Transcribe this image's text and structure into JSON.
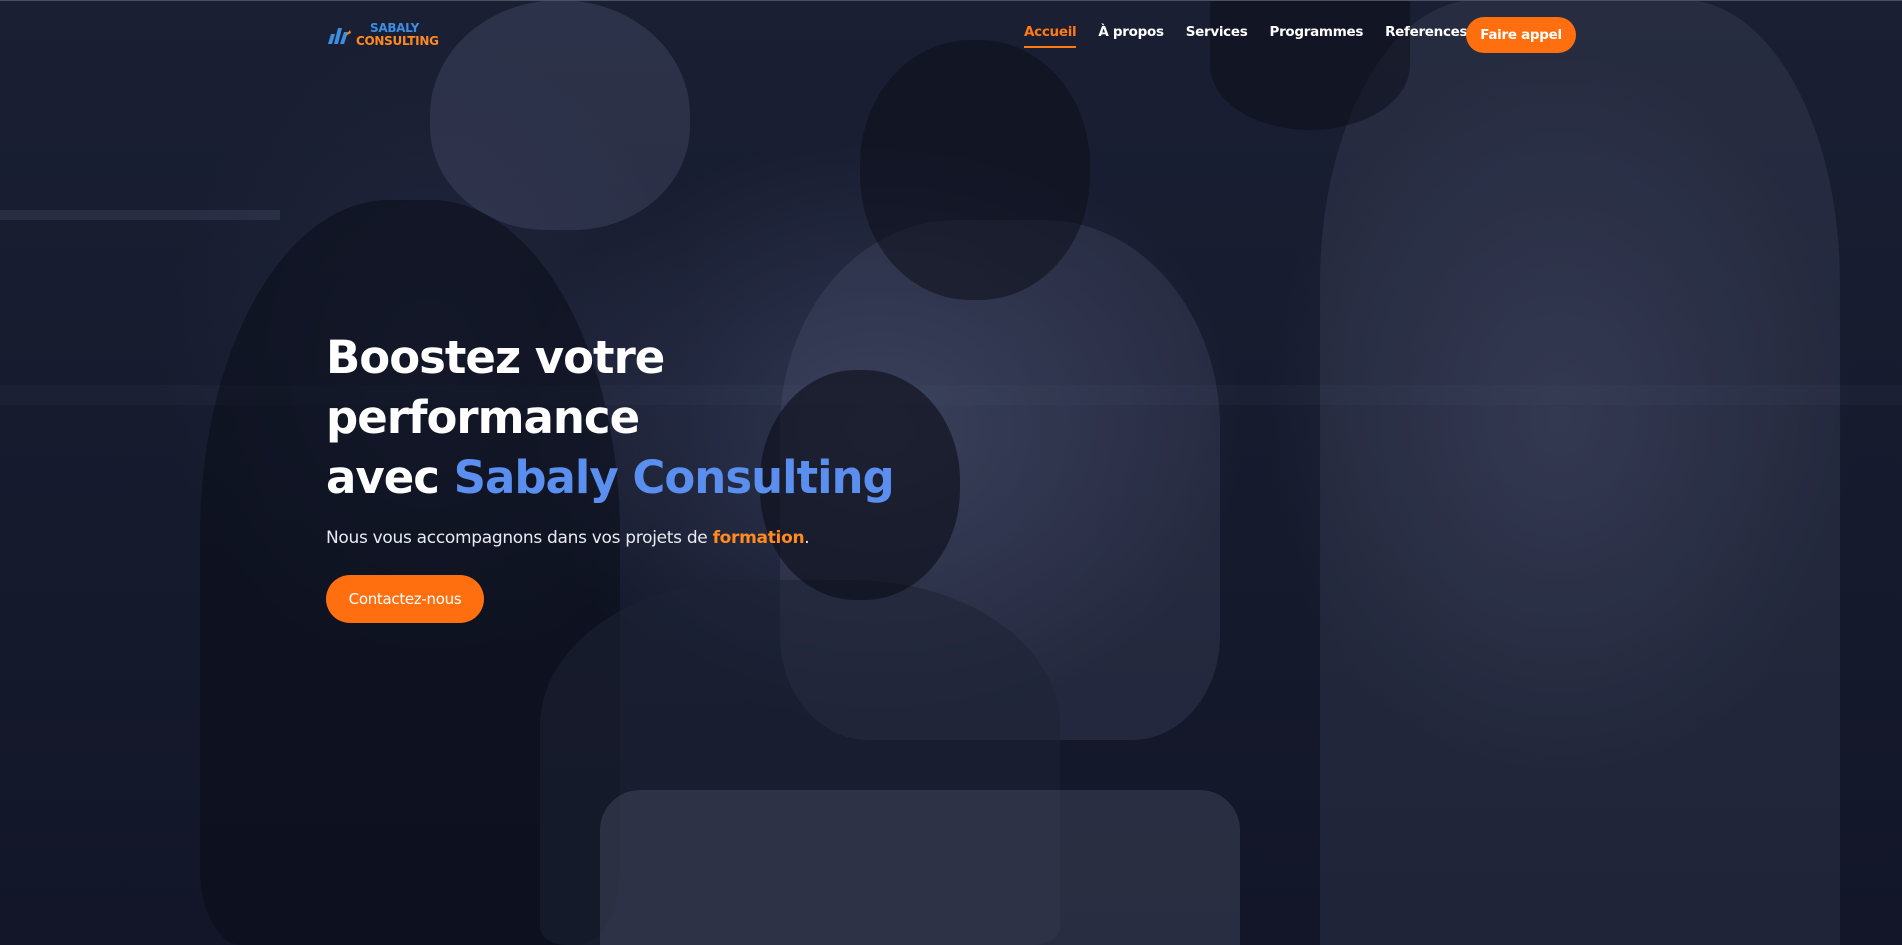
{
  "brand": {
    "name_line1": "SABALY",
    "name_line2": "CONSULTING",
    "icon": "bar-chart-logo-icon"
  },
  "nav": {
    "items": [
      {
        "label": "Accueil",
        "active": true
      },
      {
        "label": "À propos",
        "active": false
      },
      {
        "label": "Services",
        "active": false
      },
      {
        "label": "Programmes",
        "active": false
      },
      {
        "label": "References",
        "active": false
      }
    ],
    "cta_label": "Faire appel"
  },
  "hero": {
    "title_line1": "Boostez votre",
    "title_line2": "performance",
    "title_line3_prefix": "avec ",
    "title_line3_accent": "Sabaly Consulting",
    "subtitle_prefix": "Nous vous accompagnons dans vos projets de ",
    "subtitle_highlight": "formation",
    "subtitle_suffix": ".",
    "button_label": "Contactez-nous"
  },
  "colors": {
    "accent_orange": "#ff6f0f",
    "accent_blue": "#5b8fef",
    "overlay_dark": "#151a2d"
  }
}
